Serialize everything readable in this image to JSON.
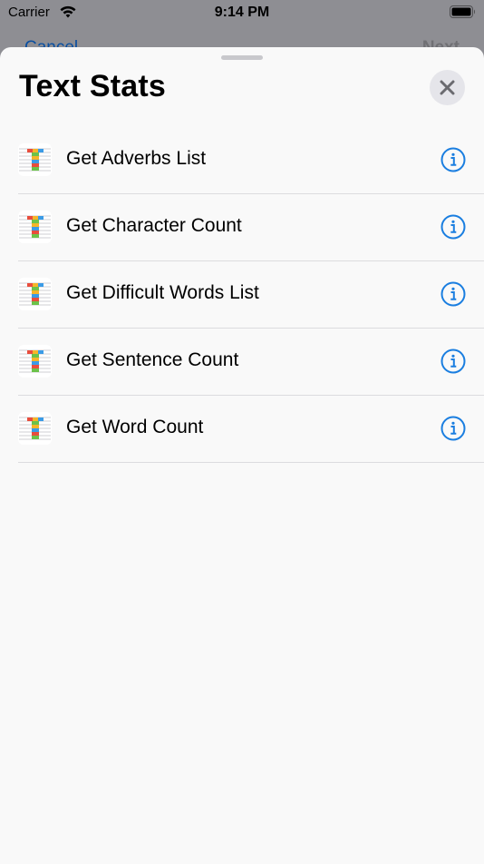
{
  "status_bar": {
    "carrier": "Carrier",
    "time": "9:14 PM",
    "wifi_icon": "wifi-icon",
    "battery_icon": "battery-icon"
  },
  "background_nav": {
    "cancel_label": "Cancel",
    "next_label": "Next"
  },
  "sheet": {
    "title": "Text Stats",
    "close_icon": "close-icon",
    "items": [
      {
        "label": "Get Adverbs List",
        "icon": "text-stats-app-icon",
        "info_icon": "info-icon"
      },
      {
        "label": "Get Character Count",
        "icon": "text-stats-app-icon",
        "info_icon": "info-icon"
      },
      {
        "label": "Get Difficult Words List",
        "icon": "text-stats-app-icon",
        "info_icon": "info-icon"
      },
      {
        "label": "Get Sentence Count",
        "icon": "text-stats-app-icon",
        "info_icon": "info-icon"
      },
      {
        "label": "Get Word Count",
        "icon": "text-stats-app-icon",
        "info_icon": "info-icon"
      }
    ]
  },
  "colors": {
    "accent": "#1a7ee0",
    "sheet_background": "#f9f9f9",
    "dimmed_background": "#8e8e93",
    "separator": "#dcdcdf"
  }
}
